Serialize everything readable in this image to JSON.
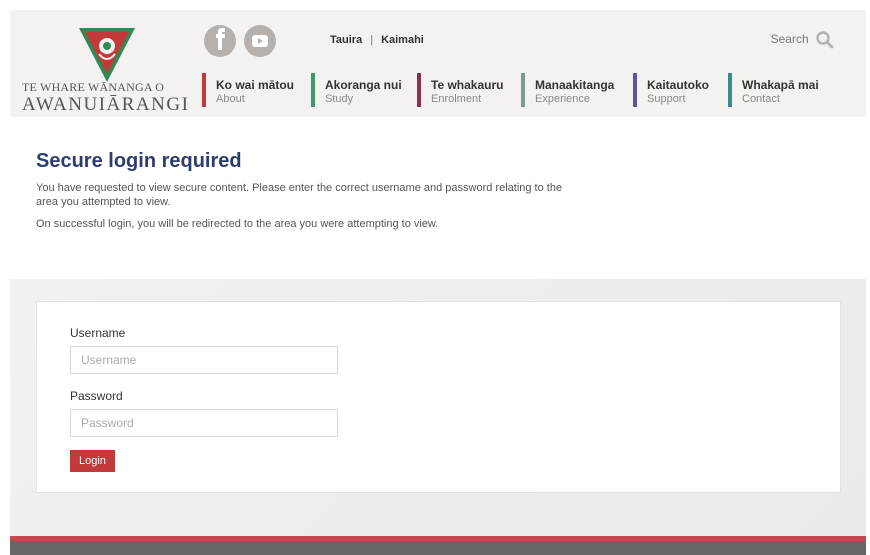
{
  "logo": {
    "line1": "TE WHARE WĀNANGA O",
    "line2": "AWANUIĀRANGI"
  },
  "social": {
    "facebook_icon": "facebook-icon",
    "youtube_icon": "youtube-icon"
  },
  "toplinks": {
    "tauira": "Tauira",
    "separator": "|",
    "kaimahi": "Kaimahi"
  },
  "search": {
    "label": "Search",
    "icon": "search-icon"
  },
  "nav": [
    {
      "maori": "Ko wai mātou",
      "english": "About",
      "color": "#c23a3a"
    },
    {
      "maori": "Akoranga nui",
      "english": "Study",
      "color": "#3a9a6a"
    },
    {
      "maori": "Te whakauru",
      "english": "Enrolment",
      "color": "#8c2f4a"
    },
    {
      "maori": "Manaakitanga",
      "english": "Experience",
      "color": "#7a9a8c"
    },
    {
      "maori": "Kaitautoko",
      "english": "Support",
      "color": "#5a5a9a"
    },
    {
      "maori": "Whakapā mai",
      "english": "Contact",
      "color": "#3a8a8c"
    }
  ],
  "page": {
    "title": "Secure login required",
    "para1": "You have requested to view secure content. Please enter the correct username and password relating to the area you attempted to view.",
    "para2": "On successful login, you will be redirected to the area you were attempting to view."
  },
  "login": {
    "username_label": "Username",
    "username_placeholder": "Username",
    "password_label": "Password",
    "password_placeholder": "Password",
    "button": "Login"
  }
}
